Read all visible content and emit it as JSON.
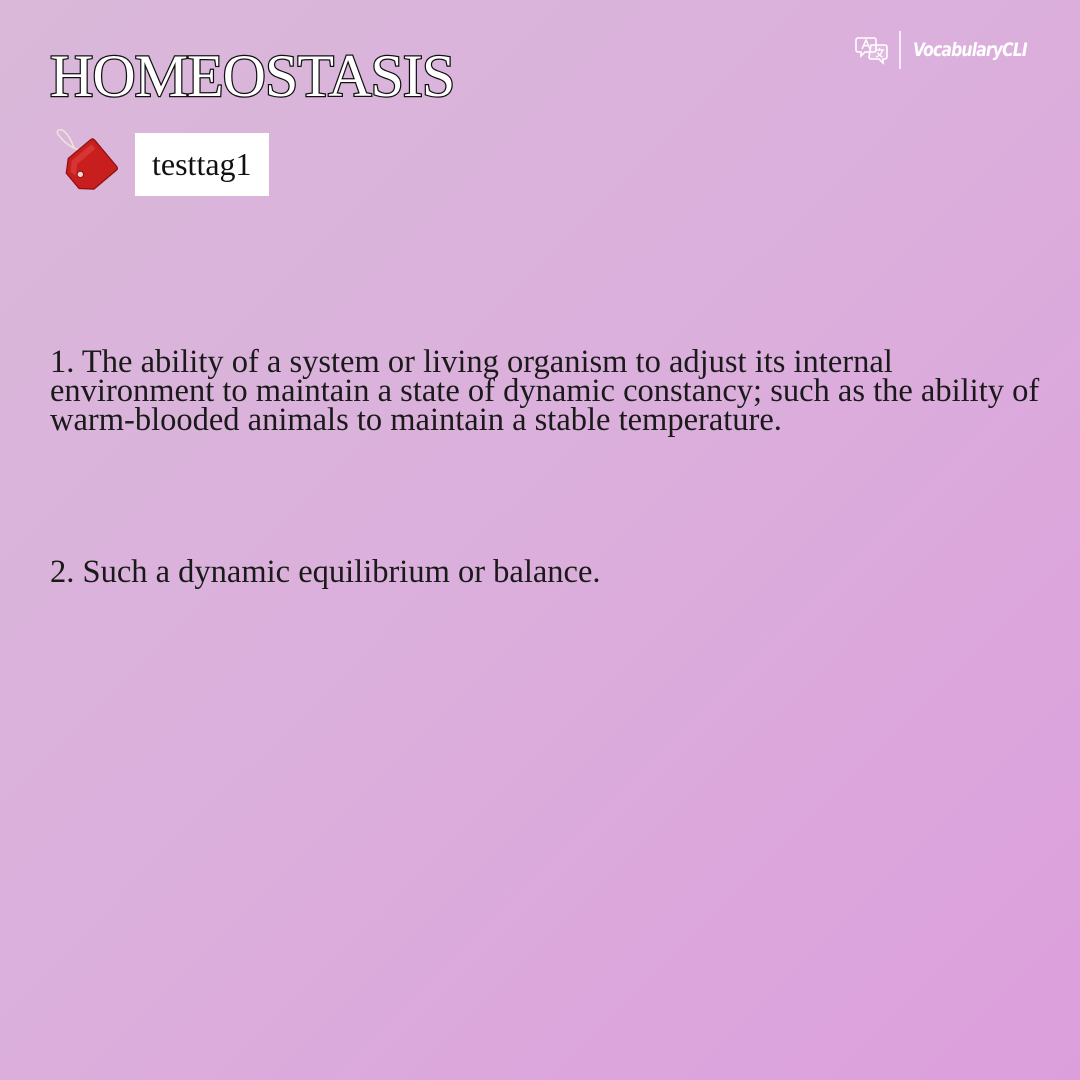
{
  "word": "HOMEOSTASIS",
  "brand": {
    "icon": "translate-icon",
    "name": "VocabularyCLI"
  },
  "tag": {
    "icon": "price-tag-icon",
    "label": "testtag1"
  },
  "definitions": [
    {
      "text": "1. The ability of a system or living organism to adjust its internal environment to maintain a state of dynamic constancy; such as the ability of warm-blooded animals to maintain a stable temperature."
    },
    {
      "text": "2. Such a dynamic equilibrium or balance."
    }
  ],
  "colors": {
    "background_start": "#d9b8d9",
    "background_end": "#dc9fdc",
    "tag_red": "#c81e1e",
    "text": "#1a1a1a"
  }
}
